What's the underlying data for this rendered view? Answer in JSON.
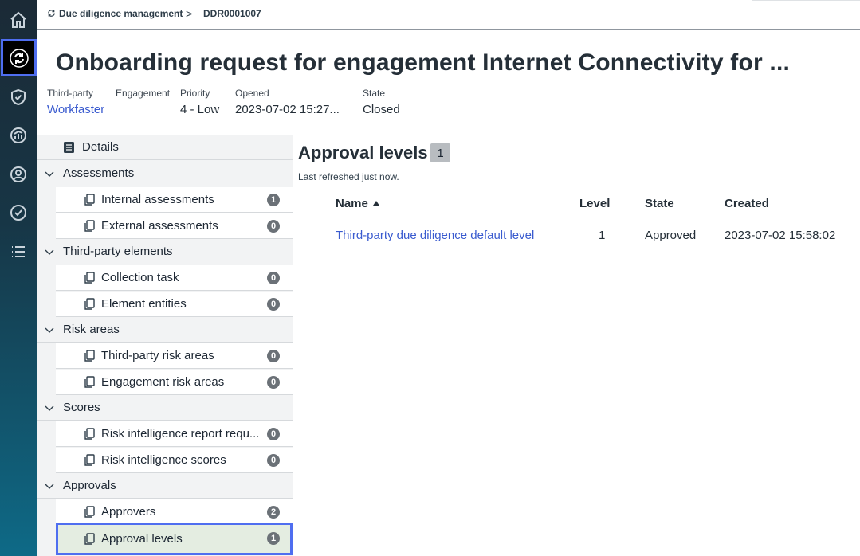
{
  "breadcrumb": {
    "parent": "Due diligence management",
    "separator": ">",
    "current": "DDR0001007"
  },
  "rail": {
    "items": [
      {
        "icon": "home-icon"
      },
      {
        "icon": "refresh-cycle-icon",
        "active": true
      },
      {
        "icon": "shield-check-icon"
      },
      {
        "icon": "gauge-chart-icon"
      },
      {
        "icon": "user-circle-icon"
      },
      {
        "icon": "check-circle-icon"
      },
      {
        "icon": "list-icon"
      }
    ]
  },
  "title": "Onboarding request for engagement Internet Connectivity for ...",
  "meta": {
    "third_party_label": "Third-party",
    "third_party_value": "Workfaster",
    "engagement_label": "Engagement",
    "priority_label": "Priority",
    "priority_value": "4 - Low",
    "opened_label": "Opened",
    "opened_value": "2023-07-02 15:27...",
    "state_label": "State",
    "state_value": "Closed"
  },
  "tree": {
    "details": "Details",
    "assessments": {
      "label": "Assessments",
      "internal": {
        "label": "Internal assessments",
        "count": "1"
      },
      "external": {
        "label": "External assessments",
        "count": "0"
      }
    },
    "third_party_elements": {
      "label": "Third-party elements",
      "collection": {
        "label": "Collection task",
        "count": "0"
      },
      "entities": {
        "label": "Element entities",
        "count": "0"
      }
    },
    "risk_areas": {
      "label": "Risk areas",
      "third_party": {
        "label": "Third-party risk areas",
        "count": "0"
      },
      "engagement": {
        "label": "Engagement risk areas",
        "count": "0"
      }
    },
    "scores": {
      "label": "Scores",
      "report": {
        "label": "Risk intelligence report requ...",
        "count": "0"
      },
      "scores": {
        "label": "Risk intelligence scores",
        "count": "0"
      }
    },
    "approvals": {
      "label": "Approvals",
      "approvers": {
        "label": "Approvers",
        "count": "2"
      },
      "levels": {
        "label": "Approval levels",
        "count": "1"
      }
    }
  },
  "main": {
    "title": "Approval levels",
    "count": "1",
    "refreshed": "Last refreshed just now.",
    "columns": {
      "name": "Name",
      "level": "Level",
      "state": "State",
      "created": "Created"
    },
    "rows": [
      {
        "name": "Third-party due diligence default level",
        "level": "1",
        "state": "Approved",
        "created": "2023-07-02 15:58:02"
      }
    ]
  },
  "colors": {
    "accent": "#4f6ef0",
    "link": "#3a5bcf",
    "selected_row": "#e4ede1",
    "badge": "#6b7177"
  }
}
